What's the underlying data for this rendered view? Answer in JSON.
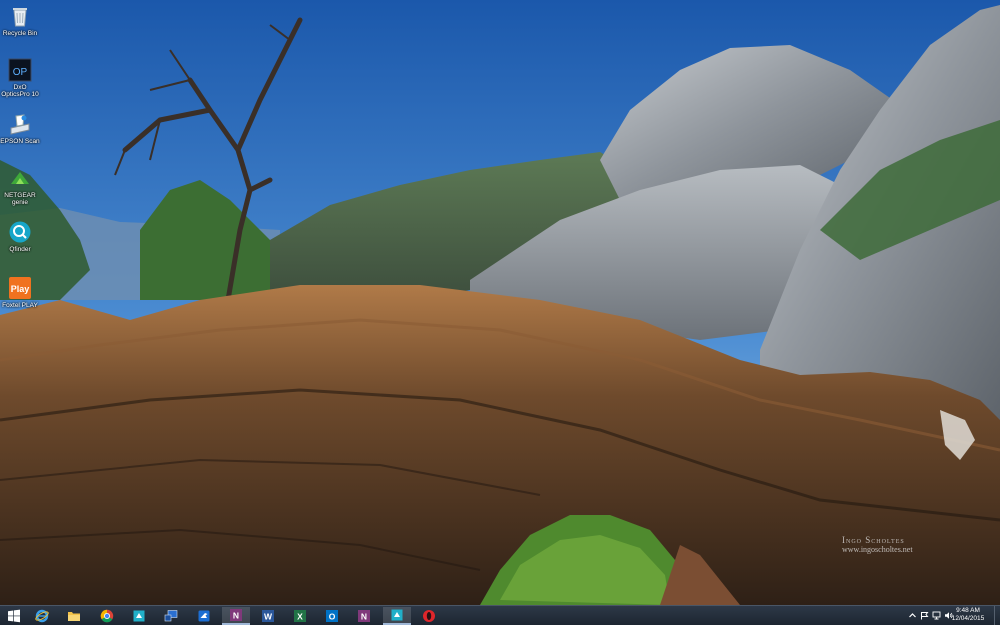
{
  "desktop": {
    "icons": [
      {
        "id": "recycle-bin",
        "label": "Recycle Bin",
        "icon": "recycle-bin-icon"
      },
      {
        "id": "dxo-opticspro",
        "label": "DxO OpticsPro 10",
        "icon": "dxo-icon",
        "badge": "OP"
      },
      {
        "id": "epson-scan",
        "label": "EPSON Scan",
        "icon": "epson-scan-icon"
      },
      {
        "id": "netgear-genie",
        "label": "NETGEAR genie",
        "icon": "netgear-icon"
      },
      {
        "id": "qfinder",
        "label": "Qfinder",
        "icon": "qfinder-icon"
      },
      {
        "id": "foxtel-play",
        "label": "Foxtel PLAY",
        "icon": "foxtel-play-icon",
        "badge": "Play"
      }
    ]
  },
  "wallpaper": {
    "watermark_line1": "Ingo Scholtes",
    "watermark_line2": "www.ingoscholtes.net"
  },
  "taskbar": {
    "pinned": [
      {
        "id": "start",
        "icon": "windows-logo-icon"
      },
      {
        "id": "internet-explorer",
        "icon": "internet-explorer-icon"
      },
      {
        "id": "file-explorer",
        "icon": "folder-icon"
      },
      {
        "id": "chrome",
        "icon": "chrome-icon"
      },
      {
        "id": "app-cyan",
        "icon": "app-cyan-icon"
      },
      {
        "id": "remote-desktop",
        "icon": "remote-desktop-icon"
      },
      {
        "id": "app-blue-bird",
        "icon": "bird-app-icon"
      },
      {
        "id": "onenote",
        "icon": "onenote-icon",
        "badge": "N"
      },
      {
        "id": "word",
        "icon": "word-icon",
        "badge": "W"
      },
      {
        "id": "excel",
        "icon": "excel-icon",
        "badge": "X"
      },
      {
        "id": "outlook",
        "icon": "outlook-icon",
        "badge": "O"
      },
      {
        "id": "onenote-2",
        "icon": "onenote-icon",
        "badge": "N"
      },
      {
        "id": "app-cyan-2",
        "icon": "app-cyan-icon"
      },
      {
        "id": "opera",
        "icon": "opera-icon"
      }
    ],
    "tray": {
      "icons": [
        "chevron-up-icon",
        "flag-icon",
        "network-icon",
        "speaker-icon"
      ],
      "time": "9:48 AM",
      "date": "12/04/2015"
    }
  },
  "colors": {
    "taskbar": "#222c38",
    "sky_top": "#1e5fb0",
    "sky_horizon": "#9ec3e6",
    "office_onenote": "#80397b",
    "office_word": "#2b579a",
    "office_excel": "#217346",
    "office_outlook": "#0072c6"
  }
}
